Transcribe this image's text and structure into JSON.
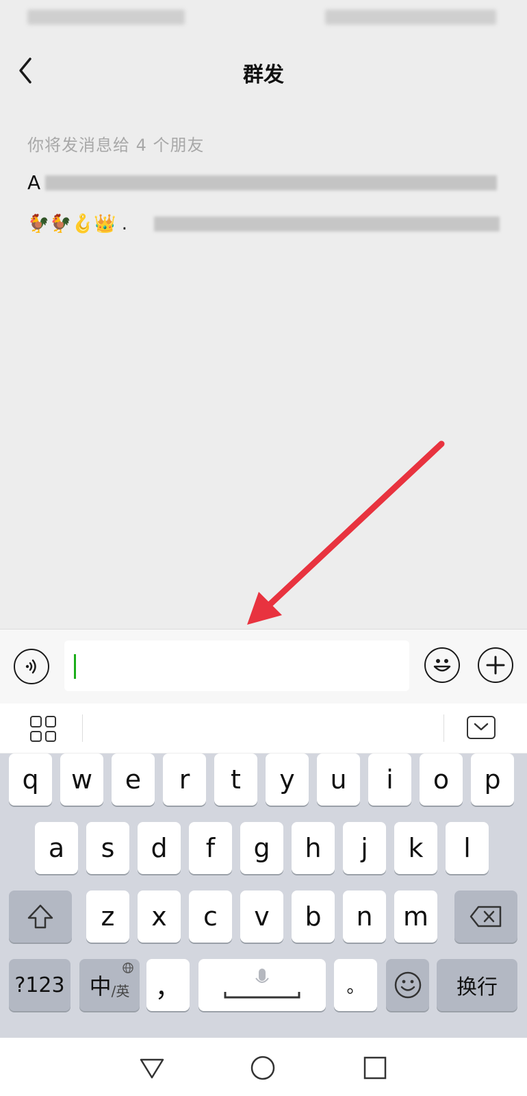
{
  "header": {
    "title": "群发"
  },
  "message": {
    "recipients_text": "你将发消息给 4 个朋友",
    "names_first_char": "A",
    "emoji_row": "🐓🐓🪝👑 ."
  },
  "keyboard": {
    "row1": [
      "q",
      "w",
      "e",
      "r",
      "t",
      "y",
      "u",
      "i",
      "o",
      "p"
    ],
    "row2": [
      "a",
      "s",
      "d",
      "f",
      "g",
      "h",
      "j",
      "k",
      "l"
    ],
    "row3": [
      "z",
      "x",
      "c",
      "v",
      "b",
      "n",
      "m"
    ],
    "numbers_label": "?123",
    "lang_label_main": "中",
    "lang_label_sub": "/英",
    "comma_label": "，",
    "period_label": "。",
    "enter_label": "换行"
  },
  "colors": {
    "accent_green": "#1aad19",
    "arrow_red": "#e8333f"
  }
}
